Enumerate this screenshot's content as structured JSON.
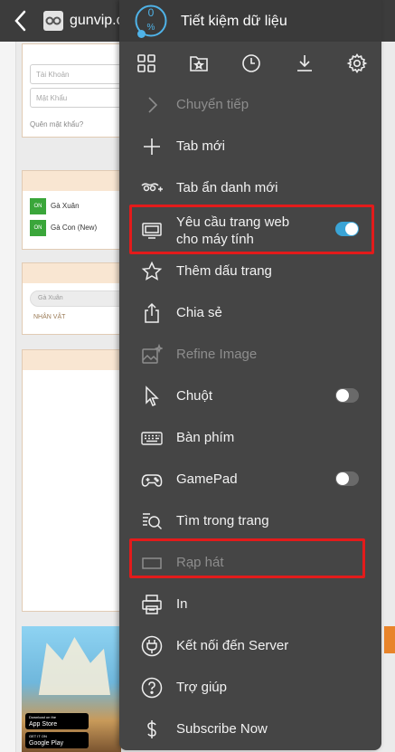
{
  "browser": {
    "url_text": "gunvip.c"
  },
  "background_page": {
    "login": {
      "username_placeholder": "Tài Khoản",
      "password_placeholder": "Mật Khẩu",
      "forgot_link": "Quên mật khẩu?"
    },
    "servers": [
      {
        "badge": "ON",
        "name": "Gà Xuân"
      },
      {
        "badge": "ON",
        "name": "Gà Con (New)"
      }
    ],
    "search_value": "Gà Xuân",
    "character_label": "NHÂN VẬT",
    "store_buttons": [
      {
        "small": "Download on the",
        "label": "App Store"
      },
      {
        "small": "GET IT ON",
        "label": "Google Play"
      }
    ]
  },
  "menu": {
    "data_saver": {
      "percent_value": "0",
      "percent_sign": "%",
      "title": "Tiết kiệm dữ liệu"
    },
    "toolbar": [
      {
        "icon": "grid-icon"
      },
      {
        "icon": "bookmark-star-icon"
      },
      {
        "icon": "clock-icon"
      },
      {
        "icon": "download-icon"
      },
      {
        "icon": "gear-icon"
      }
    ],
    "items": {
      "forward": "Chuyển tiếp",
      "new_tab": "Tab mới",
      "incognito_tab": "Tab ẩn danh mới",
      "desktop_site_line1": "Yêu cầu trang web",
      "desktop_site_line2": "cho máy tính",
      "add_bookmark": "Thêm dấu trang",
      "share": "Chia sẻ",
      "refine_image": "Refine Image",
      "mouse": "Chuột",
      "keyboard": "Bàn phím",
      "gamepad": "GamePad",
      "find_in_page": "Tìm trong trang",
      "theater": "Rạp hát",
      "print": "In",
      "connect_server": "Kết nối đến Server",
      "help": "Trợ giúp",
      "subscribe": "Subscribe Now"
    },
    "toggles": {
      "desktop_site": true,
      "mouse": false,
      "gamepad": false
    },
    "colors": {
      "accent": "#3aa4d6",
      "highlight": "#e31b1b"
    }
  }
}
